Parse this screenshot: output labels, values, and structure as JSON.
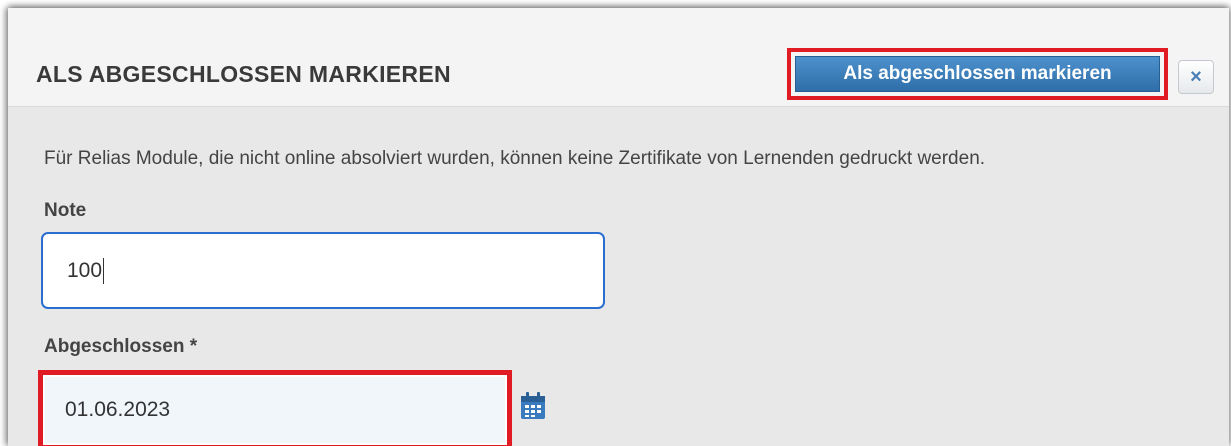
{
  "dialog": {
    "title": "ALS ABGESCHLOSSEN MARKIEREN",
    "primary_button_label": "Als abgeschlossen markieren",
    "close_label": "×",
    "info_text": "Für Relias Module, die nicht online absolviert wurden, können keine Zertifikate von Lernenden gedruckt werden."
  },
  "form": {
    "grade": {
      "label": "Note",
      "value": "100"
    },
    "completed": {
      "label": "Abgeschlossen *",
      "value": "01.06.2023",
      "icon": "calendar-icon"
    }
  },
  "colors": {
    "highlight": "#e01b24",
    "primary_button": "#3b7fbf",
    "focus_border": "#2a6fd0"
  }
}
